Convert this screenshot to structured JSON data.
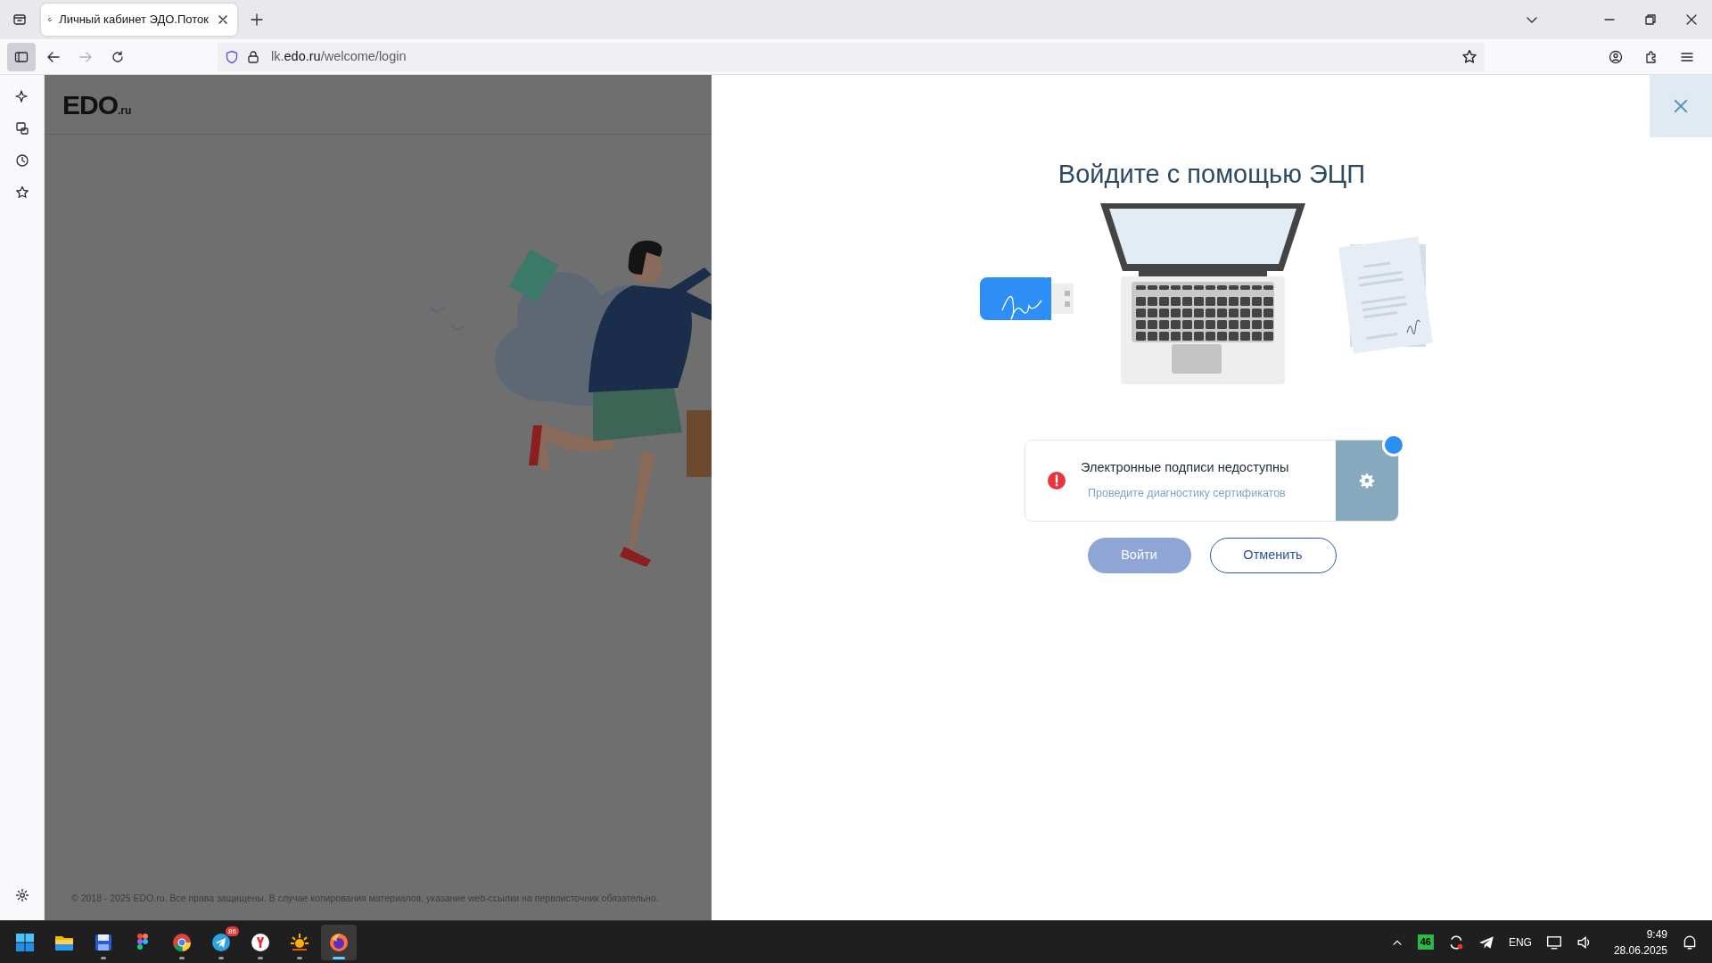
{
  "browser": {
    "tab": {
      "title": "Личный кабинет ЭДО.Поток",
      "selected": true
    },
    "address": {
      "prefix": "lk.",
      "domain": "edo.ru",
      "path": "/welcome/login"
    },
    "sidebar_toggle": {
      "selected": true
    },
    "forward": {
      "disabled": true
    }
  },
  "page": {
    "logo": {
      "text": "EDO",
      "suffix": ".ru"
    },
    "footer": "© 2018 - 2025 EDO.ru. Все права защищены. В случае копирования материалов, указание web-ссылки на первоисточник обязательно."
  },
  "dialog": {
    "title": "Войдите с помощью ЭЦП",
    "alert": {
      "title": "Электронные подписи недоступны",
      "link": "Проведите диагностику сертификатов",
      "notice_dot": true
    },
    "buttons": [
      {
        "label": "Войти",
        "kind": "primary",
        "disabled": true
      },
      {
        "label": "Отменить",
        "kind": "outline",
        "disabled": false
      }
    ]
  },
  "taskbar": {
    "apps": [
      {
        "running": false,
        "selected": false
      },
      {
        "running": false,
        "selected": false
      },
      {
        "running": true,
        "selected": false
      },
      {
        "running": false,
        "selected": false
      },
      {
        "running": true,
        "selected": false
      },
      {
        "running": true,
        "selected": false,
        "badge": "86"
      },
      {
        "running": true,
        "selected": false
      },
      {
        "running": true,
        "selected": false
      },
      {
        "running": true,
        "selected": true
      }
    ],
    "tray": {
      "counter": "46",
      "language": "ENG",
      "time": "9:49",
      "date": "28.06.2025"
    }
  }
}
